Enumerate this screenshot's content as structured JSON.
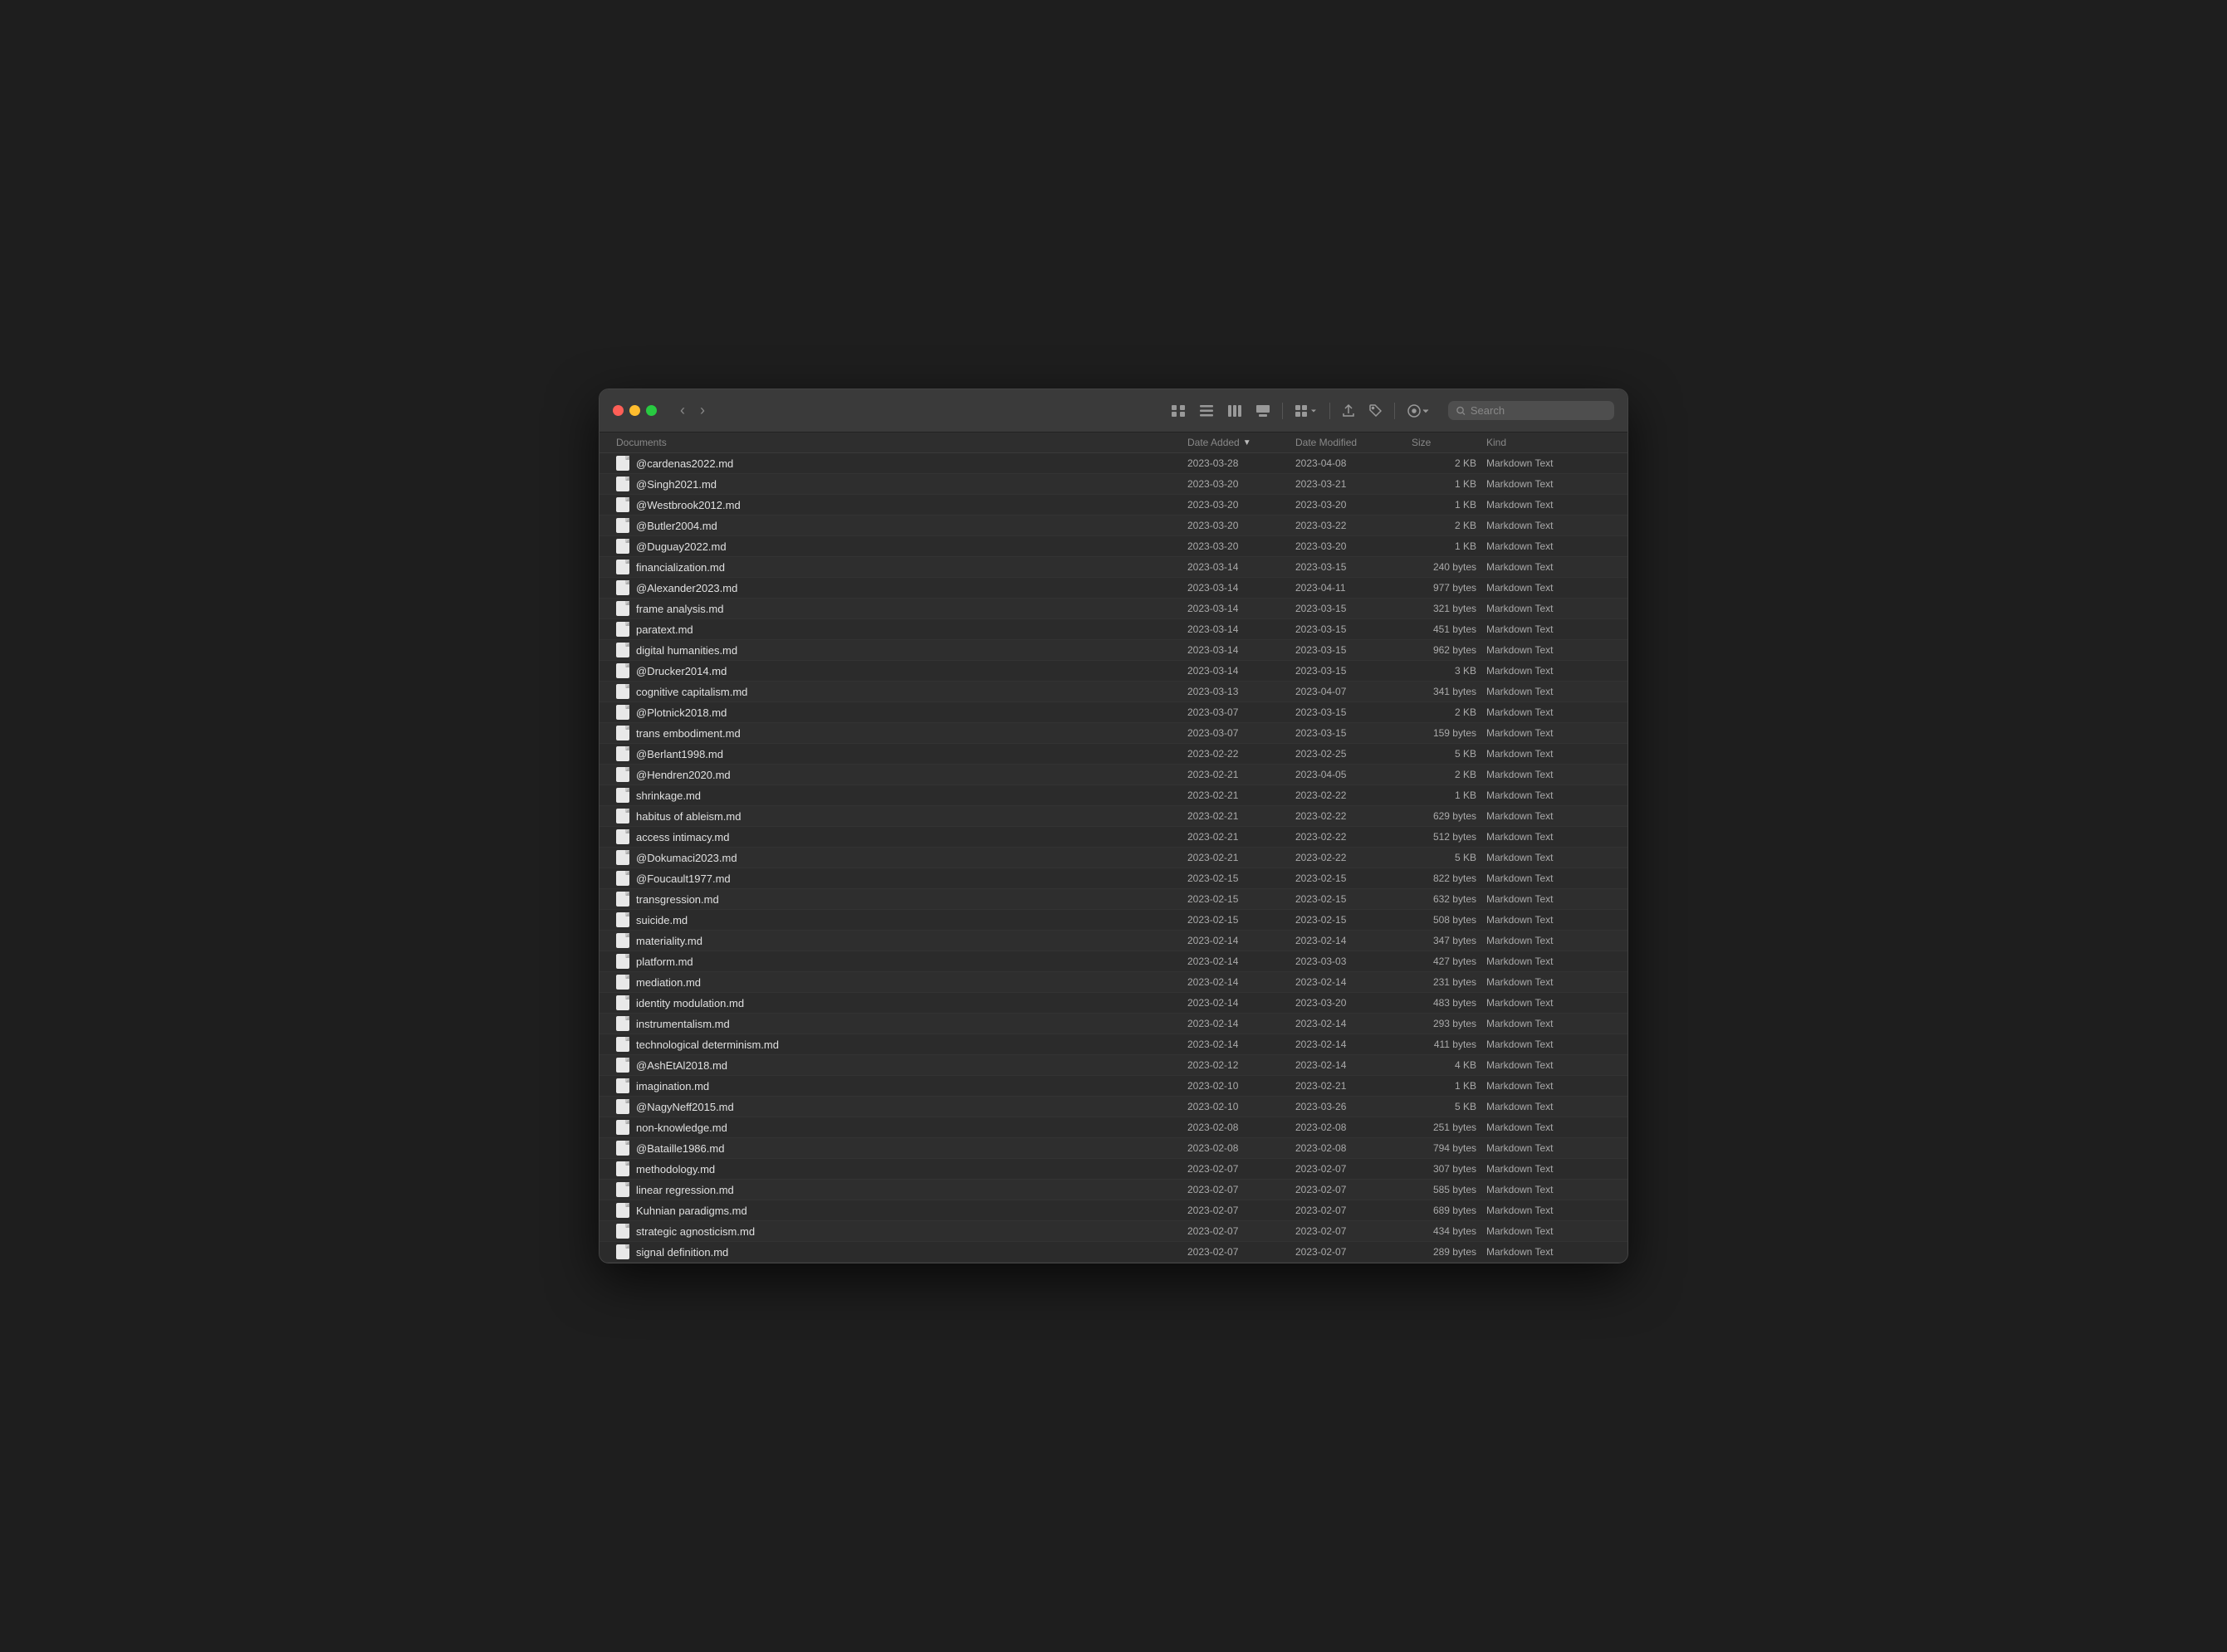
{
  "window": {
    "title": "Documents",
    "traffic_lights": [
      "close",
      "minimize",
      "maximize"
    ]
  },
  "toolbar": {
    "nav_back": "‹",
    "nav_forward": "›",
    "view_icons": "⊞",
    "view_list": "☰",
    "view_columns": "⊟",
    "view_gallery": "▣",
    "view_group": "⊞",
    "share": "↑",
    "tag": "◇",
    "action": "⊕",
    "search_placeholder": "Search"
  },
  "columns": [
    {
      "id": "name",
      "label": "Documents",
      "sortable": false
    },
    {
      "id": "date_added",
      "label": "Date Added",
      "sortable": true,
      "sort_dir": "desc"
    },
    {
      "id": "date_modified",
      "label": "Date Modified",
      "sortable": false
    },
    {
      "id": "size",
      "label": "Size",
      "sortable": false
    },
    {
      "id": "kind",
      "label": "Kind",
      "sortable": false
    }
  ],
  "files": [
    {
      "name": "@cardenas2022.md",
      "date_added": "2023-03-28",
      "date_modified": "2023-04-08",
      "size": "2 KB",
      "kind": "Markdown Text"
    },
    {
      "name": "@Singh2021.md",
      "date_added": "2023-03-20",
      "date_modified": "2023-03-21",
      "size": "1 KB",
      "kind": "Markdown Text"
    },
    {
      "name": "@Westbrook2012.md",
      "date_added": "2023-03-20",
      "date_modified": "2023-03-20",
      "size": "1 KB",
      "kind": "Markdown Text"
    },
    {
      "name": "@Butler2004.md",
      "date_added": "2023-03-20",
      "date_modified": "2023-03-22",
      "size": "2 KB",
      "kind": "Markdown Text"
    },
    {
      "name": "@Duguay2022.md",
      "date_added": "2023-03-20",
      "date_modified": "2023-03-20",
      "size": "1 KB",
      "kind": "Markdown Text"
    },
    {
      "name": "financialization.md",
      "date_added": "2023-03-14",
      "date_modified": "2023-03-15",
      "size": "240 bytes",
      "kind": "Markdown Text"
    },
    {
      "name": "@Alexander2023.md",
      "date_added": "2023-03-14",
      "date_modified": "2023-04-11",
      "size": "977 bytes",
      "kind": "Markdown Text"
    },
    {
      "name": "frame analysis.md",
      "date_added": "2023-03-14",
      "date_modified": "2023-03-15",
      "size": "321 bytes",
      "kind": "Markdown Text"
    },
    {
      "name": "paratext.md",
      "date_added": "2023-03-14",
      "date_modified": "2023-03-15",
      "size": "451 bytes",
      "kind": "Markdown Text"
    },
    {
      "name": "digital humanities.md",
      "date_added": "2023-03-14",
      "date_modified": "2023-03-15",
      "size": "962 bytes",
      "kind": "Markdown Text"
    },
    {
      "name": "@Drucker2014.md",
      "date_added": "2023-03-14",
      "date_modified": "2023-03-15",
      "size": "3 KB",
      "kind": "Markdown Text"
    },
    {
      "name": "cognitive capitalism.md",
      "date_added": "2023-03-13",
      "date_modified": "2023-04-07",
      "size": "341 bytes",
      "kind": "Markdown Text"
    },
    {
      "name": "@Plotnick2018.md",
      "date_added": "2023-03-07",
      "date_modified": "2023-03-15",
      "size": "2 KB",
      "kind": "Markdown Text"
    },
    {
      "name": "trans embodiment.md",
      "date_added": "2023-03-07",
      "date_modified": "2023-03-15",
      "size": "159 bytes",
      "kind": "Markdown Text"
    },
    {
      "name": "@Berlant1998.md",
      "date_added": "2023-02-22",
      "date_modified": "2023-02-25",
      "size": "5 KB",
      "kind": "Markdown Text"
    },
    {
      "name": "@Hendren2020.md",
      "date_added": "2023-02-21",
      "date_modified": "2023-04-05",
      "size": "2 KB",
      "kind": "Markdown Text"
    },
    {
      "name": "shrinkage.md",
      "date_added": "2023-02-21",
      "date_modified": "2023-02-22",
      "size": "1 KB",
      "kind": "Markdown Text"
    },
    {
      "name": "habitus of ableism.md",
      "date_added": "2023-02-21",
      "date_modified": "2023-02-22",
      "size": "629 bytes",
      "kind": "Markdown Text"
    },
    {
      "name": "access intimacy.md",
      "date_added": "2023-02-21",
      "date_modified": "2023-02-22",
      "size": "512 bytes",
      "kind": "Markdown Text"
    },
    {
      "name": "@Dokumaci2023.md",
      "date_added": "2023-02-21",
      "date_modified": "2023-02-22",
      "size": "5 KB",
      "kind": "Markdown Text"
    },
    {
      "name": "@Foucault1977.md",
      "date_added": "2023-02-15",
      "date_modified": "2023-02-15",
      "size": "822 bytes",
      "kind": "Markdown Text"
    },
    {
      "name": "transgression.md",
      "date_added": "2023-02-15",
      "date_modified": "2023-02-15",
      "size": "632 bytes",
      "kind": "Markdown Text"
    },
    {
      "name": "suicide.md",
      "date_added": "2023-02-15",
      "date_modified": "2023-02-15",
      "size": "508 bytes",
      "kind": "Markdown Text"
    },
    {
      "name": "materiality.md",
      "date_added": "2023-02-14",
      "date_modified": "2023-02-14",
      "size": "347 bytes",
      "kind": "Markdown Text"
    },
    {
      "name": "platform.md",
      "date_added": "2023-02-14",
      "date_modified": "2023-03-03",
      "size": "427 bytes",
      "kind": "Markdown Text"
    },
    {
      "name": "mediation.md",
      "date_added": "2023-02-14",
      "date_modified": "2023-02-14",
      "size": "231 bytes",
      "kind": "Markdown Text"
    },
    {
      "name": "identity modulation.md",
      "date_added": "2023-02-14",
      "date_modified": "2023-03-20",
      "size": "483 bytes",
      "kind": "Markdown Text"
    },
    {
      "name": "instrumentalism.md",
      "date_added": "2023-02-14",
      "date_modified": "2023-02-14",
      "size": "293 bytes",
      "kind": "Markdown Text"
    },
    {
      "name": "technological determinism.md",
      "date_added": "2023-02-14",
      "date_modified": "2023-02-14",
      "size": "411 bytes",
      "kind": "Markdown Text"
    },
    {
      "name": "@AshEtAl2018.md",
      "date_added": "2023-02-12",
      "date_modified": "2023-02-14",
      "size": "4 KB",
      "kind": "Markdown Text"
    },
    {
      "name": "imagination.md",
      "date_added": "2023-02-10",
      "date_modified": "2023-02-21",
      "size": "1 KB",
      "kind": "Markdown Text"
    },
    {
      "name": "@NagyNeff2015.md",
      "date_added": "2023-02-10",
      "date_modified": "2023-03-26",
      "size": "5 KB",
      "kind": "Markdown Text"
    },
    {
      "name": "non-knowledge.md",
      "date_added": "2023-02-08",
      "date_modified": "2023-02-08",
      "size": "251 bytes",
      "kind": "Markdown Text"
    },
    {
      "name": "@Bataille1986.md",
      "date_added": "2023-02-08",
      "date_modified": "2023-02-08",
      "size": "794 bytes",
      "kind": "Markdown Text"
    },
    {
      "name": "methodology.md",
      "date_added": "2023-02-07",
      "date_modified": "2023-02-07",
      "size": "307 bytes",
      "kind": "Markdown Text"
    },
    {
      "name": "linear regression.md",
      "date_added": "2023-02-07",
      "date_modified": "2023-02-07",
      "size": "585 bytes",
      "kind": "Markdown Text"
    },
    {
      "name": "Kuhnian paradigms.md",
      "date_added": "2023-02-07",
      "date_modified": "2023-02-07",
      "size": "689 bytes",
      "kind": "Markdown Text"
    },
    {
      "name": "strategic agnosticism.md",
      "date_added": "2023-02-07",
      "date_modified": "2023-02-07",
      "size": "434 bytes",
      "kind": "Markdown Text"
    },
    {
      "name": "signal definition.md",
      "date_added": "2023-02-07",
      "date_modified": "2023-02-07",
      "size": "289 bytes",
      "kind": "Markdown Text"
    }
  ]
}
